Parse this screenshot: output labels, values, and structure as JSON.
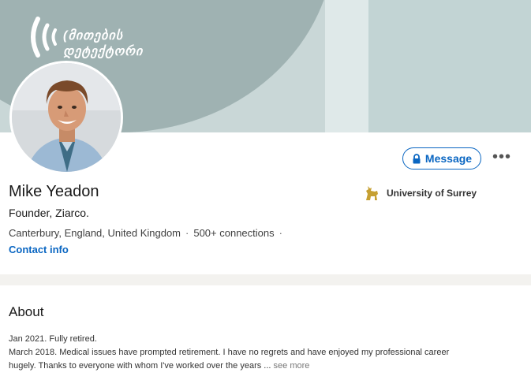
{
  "banner": {
    "logo_line1": "(მითების",
    "logo_line2": "დეტექტორი"
  },
  "profile": {
    "name": "Mike Yeadon",
    "headline": "Founder, Ziarco.",
    "location": "Canterbury, England, United Kingdom",
    "connections": "500+ connections",
    "separator": "·",
    "contact_info": "Contact info",
    "university": "University of Surrey"
  },
  "actions": {
    "message_label": "Message",
    "more_label": "•••"
  },
  "about": {
    "title": "About",
    "line1": "Jan 2021. Fully retired.",
    "line2": "March 2018. Medical issues have prompted retirement. I have no regrets and have enjoyed my professional career",
    "line3": "hugely. Thanks to everyone with whom I've worked over the years",
    "ellipsis": " ...",
    "see_more": " see more"
  },
  "colors": {
    "link": "#0a66c2",
    "banner_dark": "#9fb2b2",
    "banner_light": "#c9d7d7"
  }
}
